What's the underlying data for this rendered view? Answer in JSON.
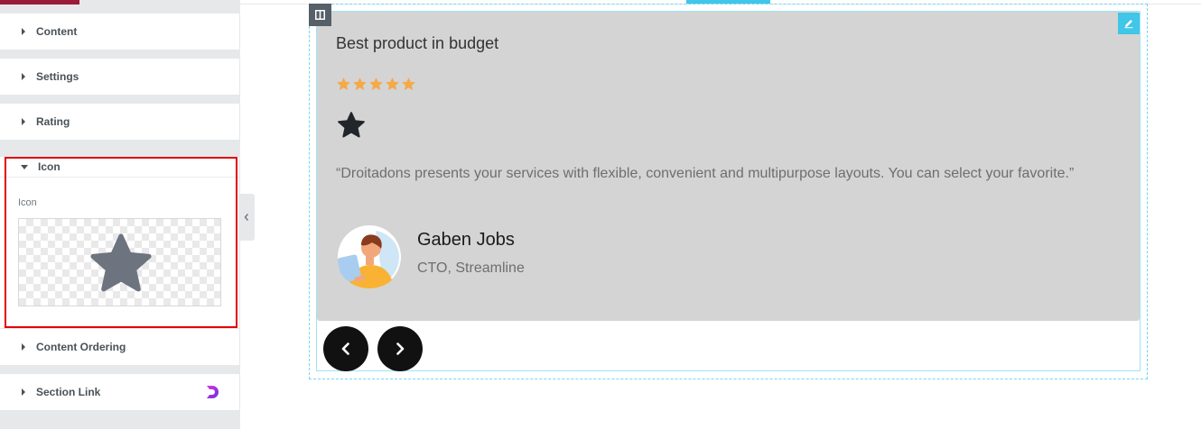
{
  "panel": {
    "sections": [
      {
        "label": "Content"
      },
      {
        "label": "Settings"
      },
      {
        "label": "Rating"
      },
      {
        "label": "Icon"
      },
      {
        "label": "Content Ordering"
      },
      {
        "label": "Section Link"
      }
    ],
    "icon_field": {
      "label": "Icon",
      "selected_icon": "star-icon"
    }
  },
  "testimonial": {
    "title": "Best product in budget",
    "rating": 5,
    "rating_max": 5,
    "quote": "“Droitadons presents your services with flexible, convenient and multipurpose layouts. You can select your favorite.”",
    "author_name": "Gaben Jobs",
    "author_role": "CTO, Streamline"
  },
  "colors": {
    "accent_red": "#e00000",
    "star_orange": "#f4a94a",
    "editor_cyan": "#3fc6e8",
    "card_bg": "#d4d4d4"
  }
}
